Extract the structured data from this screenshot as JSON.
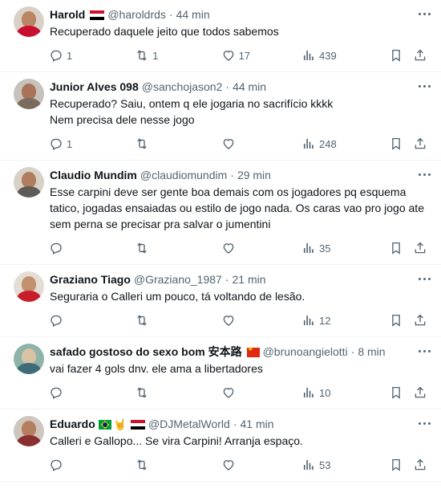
{
  "tweets": [
    {
      "name": "Harold",
      "flags": [
        "egypt"
      ],
      "handle": "@haroldrds",
      "time": "44 min",
      "text": "Recuperado daquele jeito que todos sabemos",
      "replies": "1",
      "retweets": "1",
      "likes": "17",
      "views": "439",
      "avatar_colors": {
        "bg": "#d9d0c8",
        "face": "#b98562",
        "body": "#c8102e"
      }
    },
    {
      "name": "Junior Alves 098",
      "flags": [],
      "handle": "@sanchojason2",
      "time": "44 min",
      "text": "Recuperado? Saiu, ontem q ele jogaria no sacrifício kkkk\nNem precisa dele nesse jogo",
      "replies": "1",
      "retweets": "",
      "likes": "",
      "views": "248",
      "avatar_colors": {
        "bg": "#c7c2bc",
        "face": "#a87457",
        "body": "#7b6b5f"
      }
    },
    {
      "name": "Claudio Mundim",
      "flags": [],
      "handle": "@claudiomundim",
      "time": "29 min",
      "text": "Esse carpini deve ser gente boa demais com os jogadores pq esquema tatico, jogadas ensaiadas ou estilo de jogo nada. Os caras vao pro jogo ate sem perna se precisar pra salvar o jumentini",
      "replies": "",
      "retweets": "",
      "likes": "",
      "views": "35",
      "avatar_colors": {
        "bg": "#d8d1c7",
        "face": "#b07d5e",
        "body": "#5e5a55"
      }
    },
    {
      "name": "Graziano Tiago",
      "flags": [],
      "handle": "@Graziano_1987",
      "time": "21 min",
      "text": "Seguraria o Calleri um pouco, tá voltando de lesão.",
      "replies": "",
      "retweets": "",
      "likes": "",
      "views": "12",
      "avatar_colors": {
        "bg": "#e4ddd6",
        "face": "#c2906d",
        "body": "#c81e2c"
      }
    },
    {
      "name": "safado gostoso do sexo bom 安本路",
      "flags": [
        "china"
      ],
      "handle": "@brunoangielotti",
      "time": "8 min",
      "text": "vai fazer 4 gols dnv. ele ama a libertadores",
      "replies": "",
      "retweets": "",
      "likes": "",
      "views": "10",
      "avatar_colors": {
        "bg": "#8fb3a8",
        "face": "#d9c3a5",
        "body": "#3f6b7a"
      }
    },
    {
      "name": "Eduardo",
      "flags": [
        "brazil",
        "horns",
        "egypt"
      ],
      "handle": "@DJMetalWorld",
      "time": "41 min",
      "text": "Calleri e Gallopo... Se vira Carpini! Arranja espaço.",
      "replies": "",
      "retweets": "",
      "likes": "",
      "views": "53",
      "avatar_colors": {
        "bg": "#cfc6bf",
        "face": "#b57f5f",
        "body": "#8a2f2f"
      }
    }
  ],
  "icons": {
    "reply": "reply-icon",
    "retweet": "retweet-icon",
    "like": "heart-icon",
    "views": "views-chart-icon",
    "bookmark": "bookmark-icon",
    "share": "share-icon",
    "more": "more-dots-icon"
  },
  "colors": {
    "text": "#0f1419",
    "secondary": "#536471",
    "divider": "#eff3f4"
  }
}
